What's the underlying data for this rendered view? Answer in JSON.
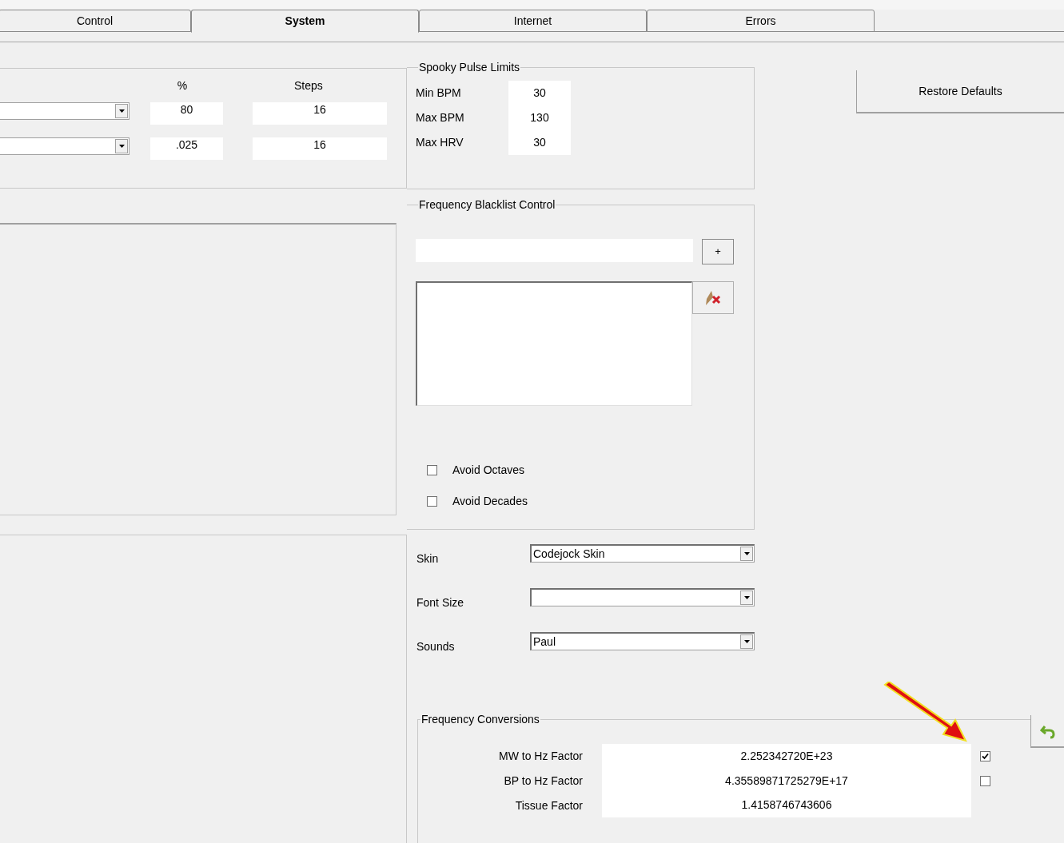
{
  "tabs": [
    {
      "label": "Control",
      "selected": false
    },
    {
      "label": "System",
      "selected": true
    },
    {
      "label": "Internet",
      "selected": false
    },
    {
      "label": "Errors",
      "selected": false
    }
  ],
  "sweep": {
    "headers": [
      "%",
      "Steps"
    ],
    "rows": [
      {
        "percent": "80",
        "steps": "16"
      },
      {
        "percent": ".025",
        "steps": "16"
      }
    ]
  },
  "spooky_pulse_limits": {
    "title": "Spooky Pulse Limits",
    "rows": [
      {
        "label": "Min BPM",
        "value": "30"
      },
      {
        "label": "Max BPM",
        "value": "130"
      },
      {
        "label": "Max HRV",
        "value": "30"
      }
    ]
  },
  "frequency_blacklist": {
    "title": "Frequency Blacklist Control",
    "add_button": "+",
    "options": [
      {
        "label": "Avoid Octaves",
        "checked": false
      },
      {
        "label": "Avoid Decades",
        "checked": false
      }
    ]
  },
  "appearance": [
    {
      "label": "Skin",
      "value": "Codejock Skin"
    },
    {
      "label": "Font Size"
    },
    {
      "label": "Sounds",
      "value": "Paul"
    }
  ],
  "restore_button": "Restore Defaults",
  "frequency_conversions": {
    "title": "Frequency Conversions",
    "rows": [
      {
        "label": "MW to Hz Factor",
        "value": "2.252342720E+23",
        "checked": true
      },
      {
        "label": "BP to Hz Factor",
        "value": "4.35589871725279E+17",
        "checked": false
      },
      {
        "label": "Tissue Factor",
        "value": "1.4158746743606"
      }
    ]
  }
}
